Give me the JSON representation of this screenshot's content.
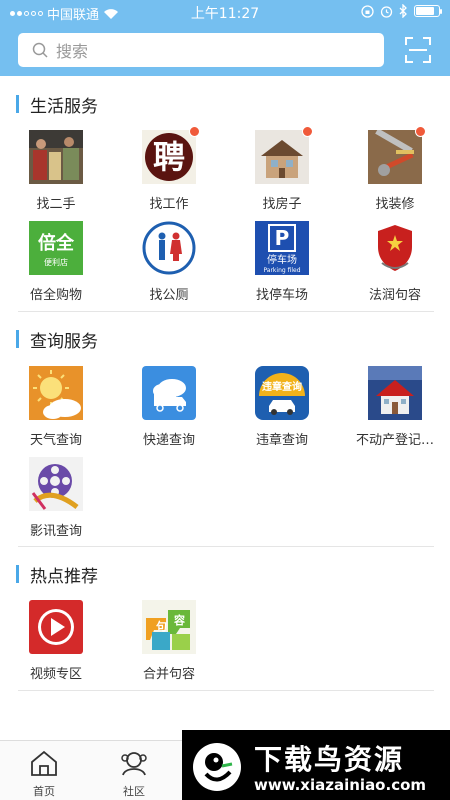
{
  "status": {
    "carrier": "中国联通",
    "time": "上午11:27"
  },
  "search": {
    "placeholder": "搜索"
  },
  "sections": [
    {
      "title": "生活服务",
      "items": [
        {
          "label": "找二手",
          "badge": false
        },
        {
          "label": "找工作",
          "badge": true
        },
        {
          "label": "找房子",
          "badge": true
        },
        {
          "label": "找装修",
          "badge": true
        },
        {
          "label": "倍全购物",
          "badge": false
        },
        {
          "label": "找公厕",
          "badge": false
        },
        {
          "label": "找停车场",
          "badge": false
        },
        {
          "label": "法润句容",
          "badge": false
        }
      ]
    },
    {
      "title": "查询服务",
      "items": [
        {
          "label": "天气查询",
          "badge": false
        },
        {
          "label": "快递查询",
          "badge": false
        },
        {
          "label": "违章查询",
          "badge": false
        },
        {
          "label": "不动产登记…",
          "badge": false
        },
        {
          "label": "影讯查询",
          "badge": false
        }
      ]
    },
    {
      "title": "热点推荐",
      "items": [
        {
          "label": "视频专区",
          "badge": false
        },
        {
          "label": "合并句容",
          "badge": false
        }
      ]
    }
  ],
  "icon_text": {
    "recruit": "聘",
    "beiquan": "倍全",
    "beiquan_sub": "便利店",
    "parking": "P",
    "parking_cn": "停车场",
    "parking_en": "Parking filed",
    "violation": "违章查询",
    "jurong_1": "句",
    "jurong_2": "容"
  },
  "tabbar": [
    {
      "label": "首页"
    },
    {
      "label": "社区"
    }
  ],
  "watermark": {
    "title": "下载鸟资源",
    "url": "www.xiazainiao.com"
  },
  "colors": {
    "topbar": "#75bff0",
    "accent_bar": "#4aa8e8",
    "badge": "#f05a3a"
  }
}
